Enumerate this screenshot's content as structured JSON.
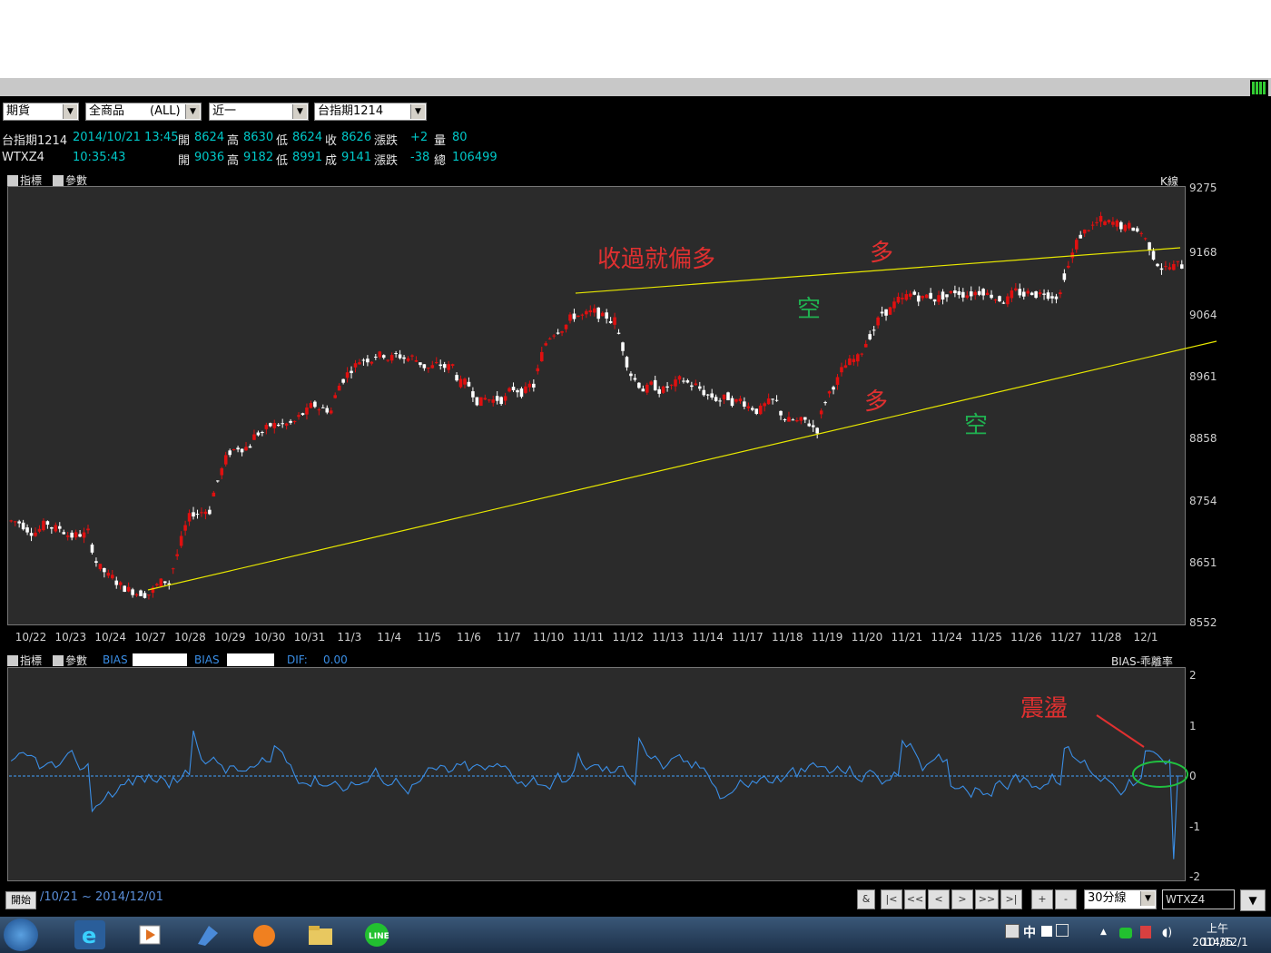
{
  "toolbar": {
    "market": "期貨",
    "product": "全商品",
    "product_all": "(ALL)",
    "range": "近一",
    "contract": "台指期1214"
  },
  "quote1": {
    "name": "台指期1214",
    "datetime": "2014/10/21 13:45",
    "open_label": "開",
    "open": "8624",
    "high_label": "高",
    "high": "8630",
    "low_label": "低",
    "low": "8624",
    "close_label": "收",
    "close": "8626",
    "chg_label": "漲跌",
    "chg": "+2",
    "vol_label": "量",
    "vol": "80"
  },
  "quote2": {
    "name": "WTXZ4",
    "time": "10:35:43",
    "open_label": "開",
    "open": "9036",
    "high_label": "高",
    "high": "9182",
    "low_label": "低",
    "low": "8991",
    "close_label": "成",
    "close": "9141",
    "chg_label": "漲跌",
    "chg": "-38",
    "vol_label": "總",
    "vol": "106499"
  },
  "main_header": {
    "indicator": "指標",
    "param": "參數",
    "k_label": "K線"
  },
  "sub_header": {
    "indicator": "指標",
    "param": "參數",
    "bias1": "BIAS",
    "bias2": "BIAS",
    "dif": "DIF:",
    "dif_value": "0.00",
    "right": "BIAS-乖離率"
  },
  "annotations": {
    "close_bull": "收過就偏多",
    "bull1": "多",
    "bear1": "空",
    "bull2": "多",
    "bear2": "空",
    "range": "震盪"
  },
  "bottom": {
    "start": "開始",
    "date_range": "/10/21 ~ 2014/12/01",
    "btn_amp": "&",
    "btn_first": "|<",
    "btn_fast_back": "<<",
    "btn_back": "<",
    "btn_fwd": ">",
    "btn_fast_fwd": ">>",
    "btn_last": ">|",
    "btn_plus": "+",
    "btn_minus": "-",
    "period": "30分線",
    "symbol": "WTXZ4"
  },
  "tray": {
    "ime": "中",
    "time": "上午 10:35",
    "date": "2014/12/1"
  },
  "chart_data": [
    {
      "type": "candlestick",
      "ylim": [
        8552,
        9275
      ],
      "y_ticks": [
        "9275",
        "9168",
        "9064",
        "8961",
        "8858",
        "8754",
        "8651",
        "8552"
      ],
      "x_ticks": [
        "10/22",
        "10/23",
        "10/24",
        "10/27",
        "10/28",
        "10/29",
        "10/30",
        "10/31",
        "11/3",
        "11/4",
        "11/5",
        "11/6",
        "11/7",
        "11/10",
        "11/11",
        "11/12",
        "11/13",
        "11/14",
        "11/17",
        "11/18",
        "11/19",
        "11/20",
        "11/21",
        "11/24",
        "11/25",
        "11/26",
        "11/27",
        "11/28",
        "12/1"
      ],
      "daily_close_approx": [
        8715,
        8698,
        8605,
        8618,
        8745,
        8855,
        8880,
        8908,
        9000,
        8993,
        8975,
        8920,
        8945,
        9065,
        9055,
        8940,
        8945,
        8925,
        8910,
        8875,
        8985,
        9085,
        9095,
        9110,
        9095,
        9110,
        9220,
        9200,
        9141
      ],
      "colors": {
        "up": "#e01010",
        "down": "#ffffff",
        "trendline": "#e8e800",
        "background": "#2b2b2b"
      }
    },
    {
      "type": "line",
      "series_label": "BIAS",
      "ylim": [
        -2,
        2
      ],
      "y_ticks": [
        "2",
        "1",
        "0",
        "-1",
        "-2"
      ],
      "colors": {
        "line": "#3a8ee6",
        "zero": "#40a0ff"
      }
    }
  ]
}
